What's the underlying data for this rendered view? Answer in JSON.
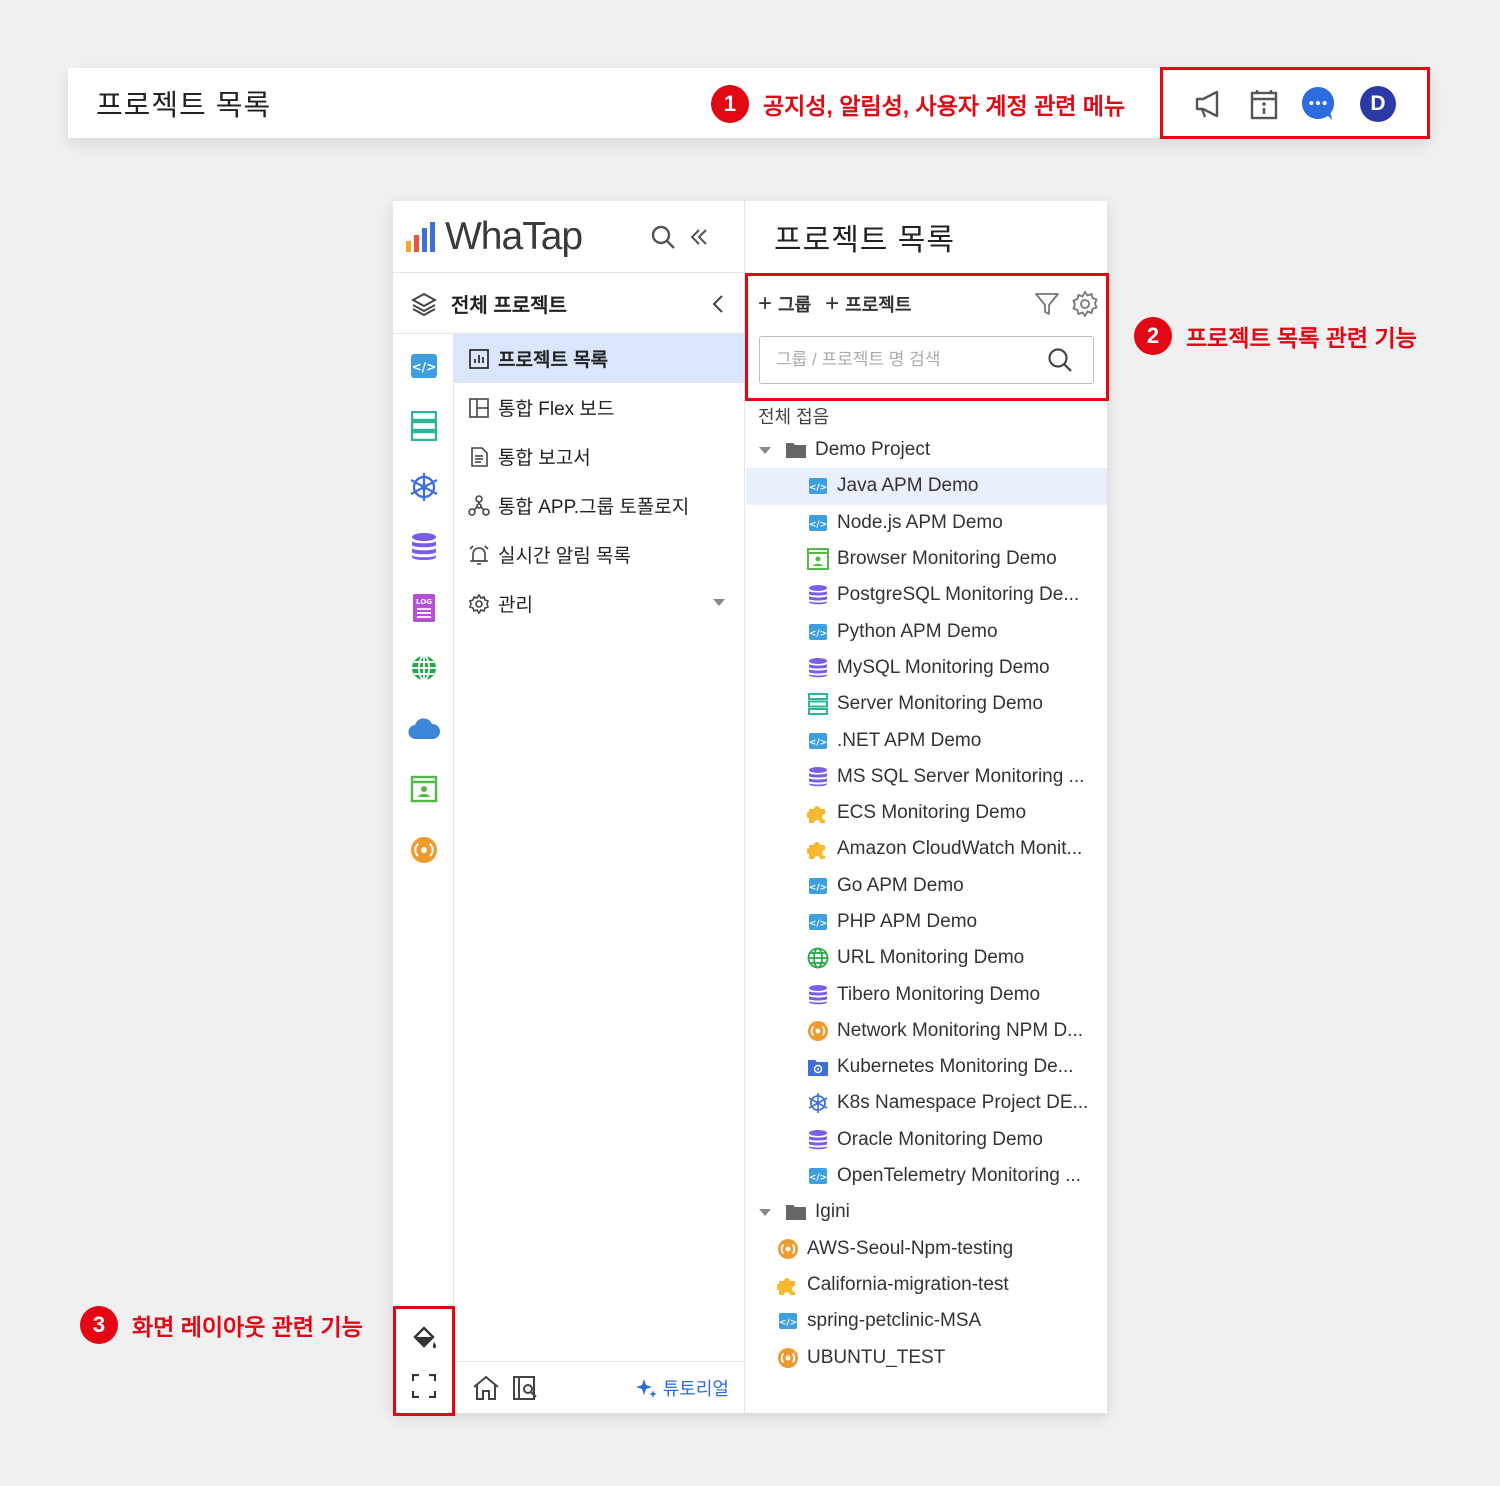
{
  "header": {
    "title": "프로젝트 목록",
    "icons": [
      "megaphone-icon",
      "notice-board-icon",
      "chat-icon",
      "user-avatar"
    ],
    "avatar_letter": "D"
  },
  "callouts": {
    "c1": {
      "num": "1",
      "text": "공지성, 알림성, 사용자 계정 관련 메뉴"
    },
    "c2": {
      "num": "2",
      "text": "프로젝트 목록 관련 기능"
    },
    "c3": {
      "num": "3",
      "text": "화면 레이아웃 관련 기능"
    }
  },
  "colors": {
    "callout_red": "#e30613",
    "active_menu_bg": "#dbe5fb",
    "selected_row_bg": "#e9effb",
    "link_blue": "#2d6cdf"
  },
  "sidebar": {
    "logo": "WhaTap",
    "project_scope": "전체 프로젝트",
    "rail_icons": [
      "apm-icon",
      "server-icon",
      "kubernetes-icon",
      "database-icon",
      "log-icon",
      "url-icon",
      "cloud-icon",
      "browser-icon",
      "network-icon"
    ],
    "menu": [
      {
        "label": "프로젝트 목록",
        "icon": "chart-icon",
        "active": true
      },
      {
        "label": "통합 Flex 보드",
        "icon": "layout-icon"
      },
      {
        "label": "통합 보고서",
        "icon": "document-icon"
      },
      {
        "label": "통합 APP.그룹 토폴로지",
        "icon": "topology-icon"
      },
      {
        "label": "실시간 알림 목록",
        "icon": "alarm-icon"
      },
      {
        "label": "관리",
        "icon": "gear-icon"
      }
    ],
    "bottom": {
      "tutorial": "튜토리얼"
    }
  },
  "main": {
    "title": "프로젝트 목록",
    "add_group": "그룹",
    "add_project": "프로젝트",
    "search_placeholder": "그룹 / 프로젝트 명 검색",
    "collapse_all": "전체 접음",
    "groups": [
      {
        "name": "Demo Project",
        "projects": [
          {
            "name": "Java APM Demo",
            "icon": "apm",
            "selected": true
          },
          {
            "name": "Node.js APM Demo",
            "icon": "apm"
          },
          {
            "name": "Browser Monitoring Demo",
            "icon": "browser"
          },
          {
            "name": "PostgreSQL Monitoring De...",
            "icon": "db"
          },
          {
            "name": "Python APM Demo",
            "icon": "apm"
          },
          {
            "name": "MySQL Monitoring Demo",
            "icon": "db"
          },
          {
            "name": "Server Monitoring Demo",
            "icon": "server"
          },
          {
            "name": ".NET APM Demo",
            "icon": "apm"
          },
          {
            "name": "MS SQL Server Monitoring ...",
            "icon": "db"
          },
          {
            "name": "ECS Monitoring Demo",
            "icon": "puzzle"
          },
          {
            "name": "Amazon CloudWatch Monit...",
            "icon": "puzzle"
          },
          {
            "name": "Go APM Demo",
            "icon": "apm"
          },
          {
            "name": "PHP APM Demo",
            "icon": "apm"
          },
          {
            "name": "URL Monitoring Demo",
            "icon": "url"
          },
          {
            "name": "Tibero Monitoring Demo",
            "icon": "db"
          },
          {
            "name": "Network Monitoring NPM D...",
            "icon": "network"
          },
          {
            "name": "Kubernetes Monitoring De...",
            "icon": "k8s-folder"
          },
          {
            "name": "K8s Namespace Project DE...",
            "icon": "k8s"
          },
          {
            "name": "Oracle Monitoring Demo",
            "icon": "db"
          },
          {
            "name": "OpenTelemetry Monitoring ...",
            "icon": "apm"
          }
        ]
      },
      {
        "name": "Igini",
        "projects": [
          {
            "name": "AWS-Seoul-Npm-testing",
            "icon": "network"
          },
          {
            "name": "California-migration-test",
            "icon": "puzzle"
          },
          {
            "name": "spring-petclinic-MSA",
            "icon": "apm"
          },
          {
            "name": "UBUNTU_TEST",
            "icon": "network"
          }
        ]
      }
    ]
  }
}
